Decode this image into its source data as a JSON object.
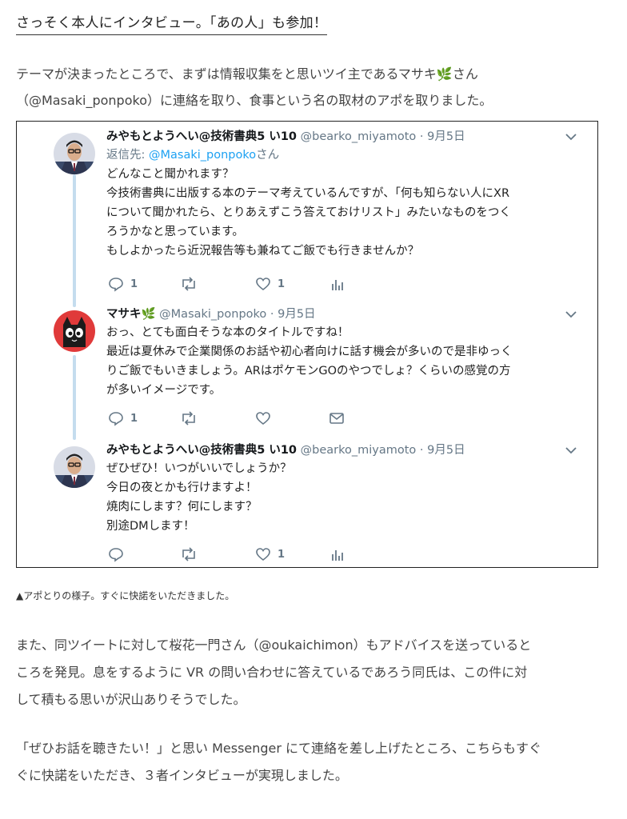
{
  "heading": "さっそく本人にインタビュー。「あの人」も参加！",
  "intro": [
    "テーマが決まったところで、まずは情報収集をと思いツイ主であるマサキ🌿さん",
    "（@Masaki_ponpoko）に連絡を取り、食事という名の取材のアポを取りました。"
  ],
  "tweets": [
    {
      "name": "みやもとようへい@技術書典5 い10",
      "handle": "@bearko_miyamoto",
      "dot": "·",
      "date": "9月5日",
      "reply_prefix": "返信先: ",
      "reply_to": "@Masaki_ponpoko",
      "reply_suffix": "さん",
      "lines": [
        "どんなこと聞かれます？",
        "今技術書典に出版する本のテーマ考えているんですが、「何も知らない人にXR",
        "について聞かれたら、とりあえずこう答えておけリスト」みたいなものをつく",
        "ろうかなと思っています。",
        "もしよかったら近況報告等も兼ねてご飯でも行きませんか？"
      ],
      "reply_count": "1",
      "like_count": "1",
      "last_icon": "analytics-icon"
    },
    {
      "name": "マサキ🌿",
      "handle": "@Masaki_ponpoko",
      "dot": "·",
      "date": "9月5日",
      "lines": [
        "おっ、とても面白そうな本のタイトルですね！",
        "最近は夏休みで企業関係のお話や初心者向けに話す機会が多いので是非ゆっく",
        "りご飯でもいきましょう。ARはポケモンGOのやつでしょ？くらいの感覚の方",
        "が多いイメージです。"
      ],
      "reply_count": "1",
      "like_count": "",
      "last_icon": "message-icon"
    },
    {
      "name": "みやもとようへい@技術書典5 い10",
      "handle": "@bearko_miyamoto",
      "dot": "·",
      "date": "9月5日",
      "lines": [
        "ぜひぜひ！いつがいいでしょうか？",
        "今日の夜とかも行けますよ！",
        "焼肉にします？何にします？",
        "別途DMします！"
      ],
      "reply_count": "",
      "like_count": "1",
      "last_icon": "analytics-icon"
    }
  ],
  "caption": "▲アポとりの様子。すぐに快諾をいただきました。",
  "para1": [
    "また、同ツイートに対して桜花一門さん（@oukaichimon）もアドバイスを送っていると",
    "ころを発見。息をするように VR の問い合わせに答えているであろう同氏は、この件に対",
    "して積もる思いが沢山ありそうでした。"
  ],
  "para2": [
    "「ぜひお話を聴きたい！」と思い Messenger にて連絡を差し上げたところ、こちらもすぐ",
    "ぐに快諾をいただき、３者インタビューが実現しました。"
  ],
  "colors": {
    "link": "#1da1f2",
    "meta": "#657786",
    "thread": "#c4dcee"
  }
}
